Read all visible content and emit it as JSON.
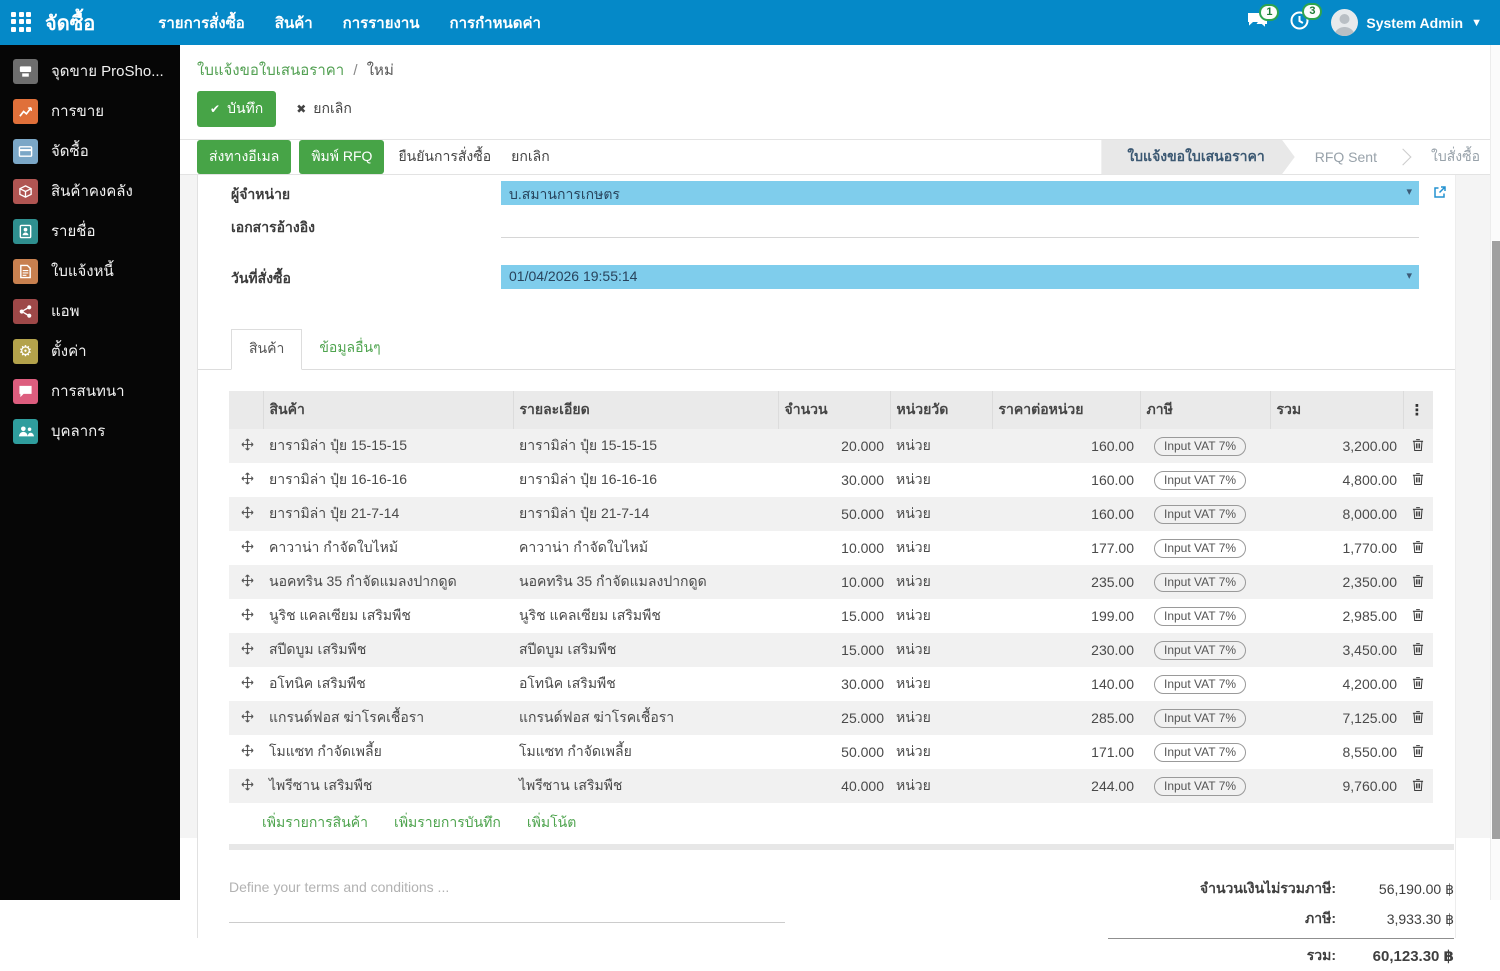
{
  "navbar": {
    "app_title": "จัดซื้อ",
    "menus": [
      "รายการสั่งซื้อ",
      "สินค้า",
      "การรายงาน",
      "การกำหนดค่า"
    ],
    "messages_count": "1",
    "activities_count": "3",
    "user": "System Admin"
  },
  "sidebar": {
    "items": [
      {
        "label": "จุดขาย ProSho...",
        "icon": "pos-icon",
        "color": "#6e6e6e"
      },
      {
        "label": "การขาย",
        "icon": "sales-icon",
        "color": "#e0703a"
      },
      {
        "label": "จัดซื้อ",
        "icon": "purchase-icon",
        "color": "#7ba7c7"
      },
      {
        "label": "สินค้าคงคลัง",
        "icon": "inventory-icon",
        "color": "#b05552"
      },
      {
        "label": "รายชื่อ",
        "icon": "contacts-icon",
        "color": "#2f8f8f"
      },
      {
        "label": "ใบแจ้งหนี้",
        "icon": "invoicing-icon",
        "color": "#c8804f"
      },
      {
        "label": "แอพ",
        "icon": "apps-icon",
        "color": "#9e4848"
      },
      {
        "label": "ตั้งค่า",
        "icon": "settings-icon",
        "color": "#b3a24b"
      },
      {
        "label": "การสนทนา",
        "icon": "discuss-icon",
        "color": "#dd5d7e"
      },
      {
        "label": "บุคลากร",
        "icon": "hr-icon",
        "color": "#2f9d9d"
      }
    ]
  },
  "breadcrumb": {
    "parent": "ใบแจ้งขอใบเสนอราคา",
    "separator": "/",
    "current": "ใหม่"
  },
  "actions": {
    "save": "บันทึก",
    "discard": "ยกเลิก"
  },
  "statusbar": {
    "buttons": [
      {
        "label": "ส่งทางอีเมล",
        "style": "primary"
      },
      {
        "label": "พิมพ์ RFQ",
        "style": "primary"
      },
      {
        "label": "ยืนยันการสั่งซื้อ",
        "style": "plain"
      },
      {
        "label": "ยกเลิก",
        "style": "plain"
      }
    ],
    "states": [
      {
        "label": "ใบแจ้งขอใบเสนอราคา",
        "active": true
      },
      {
        "label": "RFQ Sent",
        "active": false
      },
      {
        "label": "ใบสั่งซื้อ",
        "active": false
      }
    ]
  },
  "form": {
    "vendor_label": "ผู้จำหน่าย",
    "vendor_value": "บ.สมานการเกษตร",
    "reference_label": "เอกสารอ้างอิง",
    "reference_value": "",
    "date_label": "วันที่สั่งซื้อ",
    "date_value": "01/04/2026 19:55:14"
  },
  "tabs": [
    {
      "label": "สินค้า",
      "active": true
    },
    {
      "label": "ข้อมูลอื่นๆ",
      "active": false
    }
  ],
  "table": {
    "headers": [
      "สินค้า",
      "รายละเอียด",
      "จำนวน",
      "หน่วยวัด",
      "ราคาต่อหน่วย",
      "ภาษี",
      "รวม"
    ],
    "rows": [
      {
        "product": "ยารามิล่า ปุ๋ย 15-15-15",
        "description": "ยารามิล่า ปุ๋ย 15-15-15",
        "qty": "20.000",
        "uom": "หน่วย",
        "price": "160.00",
        "tax": "Input VAT 7%",
        "total": "3,200.00"
      },
      {
        "product": "ยารามิล่า ปุ๋ย 16-16-16",
        "description": "ยารามิล่า ปุ๋ย 16-16-16",
        "qty": "30.000",
        "uom": "หน่วย",
        "price": "160.00",
        "tax": "Input VAT 7%",
        "total": "4,800.00"
      },
      {
        "product": "ยารามิล่า ปุ๋ย 21-7-14",
        "description": "ยารามิล่า ปุ๋ย 21-7-14",
        "qty": "50.000",
        "uom": "หน่วย",
        "price": "160.00",
        "tax": "Input VAT 7%",
        "total": "8,000.00"
      },
      {
        "product": "คาวาน่า กำจัดใบไหม้",
        "description": "คาวาน่า กำจัดใบไหม้",
        "qty": "10.000",
        "uom": "หน่วย",
        "price": "177.00",
        "tax": "Input VAT 7%",
        "total": "1,770.00"
      },
      {
        "product": "นอคทริน 35 กำจัดแมลงปากดูด",
        "description": "นอคทริน 35 กำจัดแมลงปากดูด",
        "qty": "10.000",
        "uom": "หน่วย",
        "price": "235.00",
        "tax": "Input VAT 7%",
        "total": "2,350.00"
      },
      {
        "product": "นูริช แคลเซียม เสริมพืช",
        "description": "นูริช แคลเซียม เสริมพืช",
        "qty": "15.000",
        "uom": "หน่วย",
        "price": "199.00",
        "tax": "Input VAT 7%",
        "total": "2,985.00"
      },
      {
        "product": "สปีดบูม เสริมพืช",
        "description": "สปีดบูม เสริมพืช",
        "qty": "15.000",
        "uom": "หน่วย",
        "price": "230.00",
        "tax": "Input VAT 7%",
        "total": "3,450.00"
      },
      {
        "product": "อโทนิค เสริมพืช",
        "description": "อโทนิค เสริมพืช",
        "qty": "30.000",
        "uom": "หน่วย",
        "price": "140.00",
        "tax": "Input VAT 7%",
        "total": "4,200.00"
      },
      {
        "product": "แกรนด์ฟอส ฆ่าโรคเชื้อรา",
        "description": "แกรนด์ฟอส ฆ่าโรคเชื้อรา",
        "qty": "25.000",
        "uom": "หน่วย",
        "price": "285.00",
        "tax": "Input VAT 7%",
        "total": "7,125.00"
      },
      {
        "product": "โมแซท กำจัดเพลี้ย",
        "description": "โมแซท กำจัดเพลี้ย",
        "qty": "50.000",
        "uom": "หน่วย",
        "price": "171.00",
        "tax": "Input VAT 7%",
        "total": "8,550.00"
      },
      {
        "product": "ไพรีซาน เสริมพืช",
        "description": "ไพรีซาน เสริมพืช",
        "qty": "40.000",
        "uom": "หน่วย",
        "price": "244.00",
        "tax": "Input VAT 7%",
        "total": "9,760.00"
      }
    ]
  },
  "footer_links": [
    "เพิ่มรายการสินค้า",
    "เพิ่มรายการบันทึก",
    "เพิ่มโน้ต"
  ],
  "terms_placeholder": "Define your terms and conditions ...",
  "totals": {
    "untaxed_label": "จำนวนเงินไม่รวมภาษี:",
    "untaxed_value": "56,190.00 ฿",
    "tax_label": "ภาษี:",
    "tax_value": "3,933.30 ฿",
    "total_label": "รวม:",
    "total_value": "60,123.30 ฿"
  },
  "colors": {
    "navbar": "#0589c8",
    "primary_button": "#47a447",
    "link_green": "#52a052",
    "selected_field": "#7fcdec",
    "active_state_text": "#3b5872"
  }
}
